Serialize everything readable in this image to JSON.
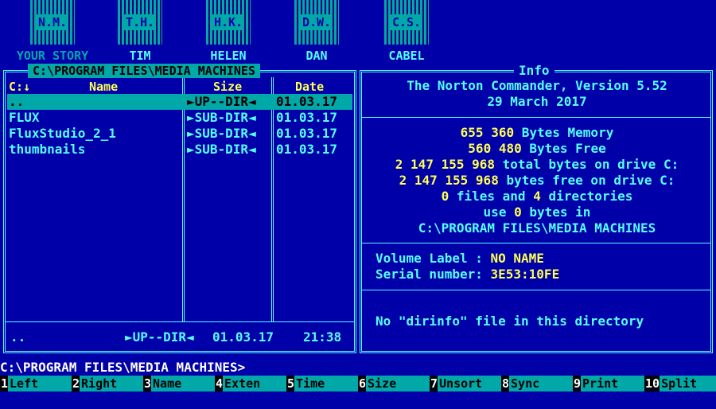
{
  "shortcuts": [
    {
      "tile": "N.M.",
      "label": "YOUR STORY"
    },
    {
      "tile": "T.H.",
      "label": "TIM"
    },
    {
      "tile": "H.K.",
      "label": "HELEN"
    },
    {
      "tile": "D.W.",
      "label": "DAN"
    },
    {
      "tile": "C.S.",
      "label": "CABEL"
    }
  ],
  "left_panel": {
    "path": "C:\\PROGRAM FILES\\MEDIA MACHINES",
    "drive_indicator": "C:↓",
    "columns": {
      "name": "Name",
      "size": "Size",
      "date": "Date"
    },
    "rows": [
      {
        "name": "..",
        "size": "►UP--DIR◄",
        "date": "01.03.17"
      },
      {
        "name": "FLUX",
        "size": "►SUB-DIR◄",
        "date": "01.03.17"
      },
      {
        "name": "FluxStudio_2_1",
        "size": "►SUB-DIR◄",
        "date": "01.03.17"
      },
      {
        "name": "thumbnails",
        "size": "►SUB-DIR◄",
        "date": "01.03.17"
      }
    ],
    "footer": {
      "name": "..",
      "size": "►UP--DIR◄",
      "date": "01.03.17",
      "time": "21:38"
    }
  },
  "info_panel": {
    "title": "Info",
    "version": "The Norton Commander, Version 5.52",
    "date": "29 March 2017",
    "memory": {
      "value": "655 360",
      "label": "Bytes Memory"
    },
    "free": {
      "value": "560 480",
      "label": "Bytes Free"
    },
    "total_drive": {
      "value": "2 147 155 968",
      "label": "total bytes on drive C:"
    },
    "free_drive": {
      "value": "2 147 155 968",
      "label": "bytes free on drive C:"
    },
    "counts": {
      "files": "0",
      "files_label": "files and",
      "dirs": "4",
      "dirs_label": "directories"
    },
    "use": {
      "pre": "use",
      "value": "0",
      "post": "bytes in"
    },
    "path": "C:\\PROGRAM FILES\\MEDIA MACHINES",
    "volume_label_key": "Volume Label :",
    "volume_label_value": "NO NAME",
    "serial_key": "Serial number:",
    "serial_value": "3E53:10FE",
    "dirinfo": "No \"dirinfo\" file in this directory"
  },
  "command_line": "C:\\PROGRAM FILES\\MEDIA MACHINES>",
  "fkeys": [
    {
      "num": "1",
      "label": "Left"
    },
    {
      "num": "2",
      "label": "Right"
    },
    {
      "num": "3",
      "label": "Name"
    },
    {
      "num": "4",
      "label": "Exten"
    },
    {
      "num": "5",
      "label": "Time"
    },
    {
      "num": "6",
      "label": "Size"
    },
    {
      "num": "7",
      "label": "Unsort"
    },
    {
      "num": "8",
      "label": "Sync"
    },
    {
      "num": "9",
      "label": "Print"
    },
    {
      "num": "10",
      "label": "Split"
    }
  ]
}
